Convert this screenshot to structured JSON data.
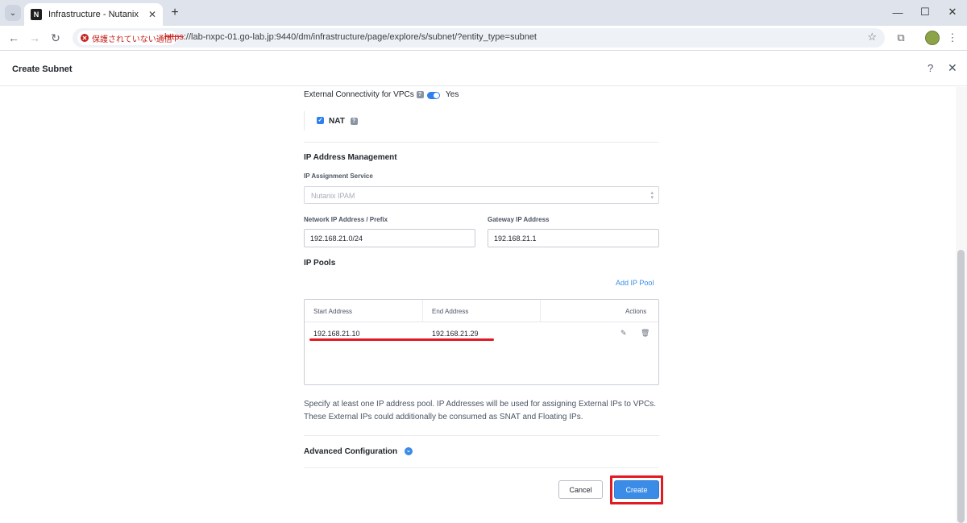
{
  "browser": {
    "tab_title": "Infrastructure - Nutanix",
    "tab_favicon": "N",
    "insecure_label": "保護されていない通信",
    "url_scheme": "https",
    "url_rest": "://lab-nxpc-01.go-lab.jp:9440/dm/infrastructure/page/explore/s/subnet/?entity_type=subnet"
  },
  "modal": {
    "title": "Create Subnet",
    "help": "?",
    "close": "✕"
  },
  "form": {
    "external_connectivity_label": "External Connectivity for VPCs",
    "external_connectivity_value": "Yes",
    "nat_label": "NAT",
    "ipam_title": "IP Address Management",
    "ip_assignment_label": "IP Assignment Service",
    "ip_assignment_value": "Nutanix IPAM",
    "network_label": "Network IP Address / Prefix",
    "network_value": "192.168.21.0/24",
    "gateway_label": "Gateway IP Address",
    "gateway_value": "192.168.21.1",
    "pools_title": "IP Pools",
    "add_pool_link": "Add IP Pool",
    "pools_table": {
      "headers": [
        "Start Address",
        "End Address",
        "Actions"
      ],
      "rows": [
        {
          "start": "192.168.21.10",
          "end": "192.168.21.29"
        }
      ]
    },
    "description": "Specify at least one IP address pool. IP Addresses will be used for assigning External IPs to VPCs. These External IPs could additionally be consumed as SNAT and Floating IPs.",
    "advanced_label": "Advanced Configuration"
  },
  "footer": {
    "cancel_label": "Cancel",
    "create_label": "Create"
  },
  "colors": {
    "accent": "#3b8ce6",
    "highlight": "#e01b24"
  }
}
